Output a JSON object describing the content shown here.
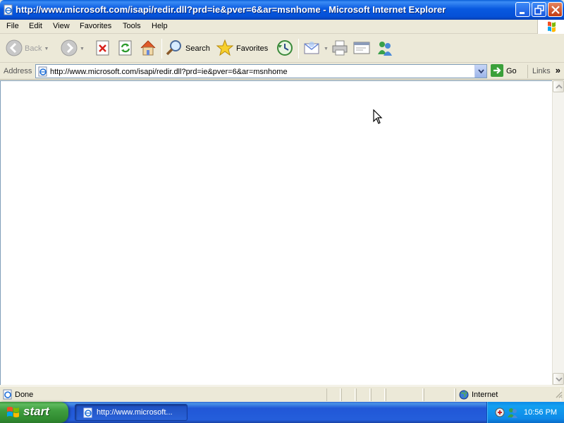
{
  "window": {
    "title": "http://www.microsoft.com/isapi/redir.dll?prd=ie&pver=6&ar=msnhome - Microsoft Internet Explorer"
  },
  "menu": {
    "file": "File",
    "edit": "Edit",
    "view": "View",
    "favorites": "Favorites",
    "tools": "Tools",
    "help": "Help"
  },
  "toolbar": {
    "back_label": "Back",
    "search_label": "Search",
    "favorites_label": "Favorites"
  },
  "address": {
    "label": "Address",
    "url": "http://www.microsoft.com/isapi/redir.dll?prd=ie&pver=6&ar=msnhome",
    "go_label": "Go",
    "links_label": "Links"
  },
  "status": {
    "text": "Done",
    "zone": "Internet"
  },
  "taskbar": {
    "start_label": "start",
    "task_label": "http://www.microsoft...",
    "clock": "10:56 PM"
  },
  "colors": {
    "titlebar": "#0550d6",
    "chrome": "#ece9d8",
    "start_green": "#3f9e3f",
    "taskbar_blue": "#245edb"
  }
}
